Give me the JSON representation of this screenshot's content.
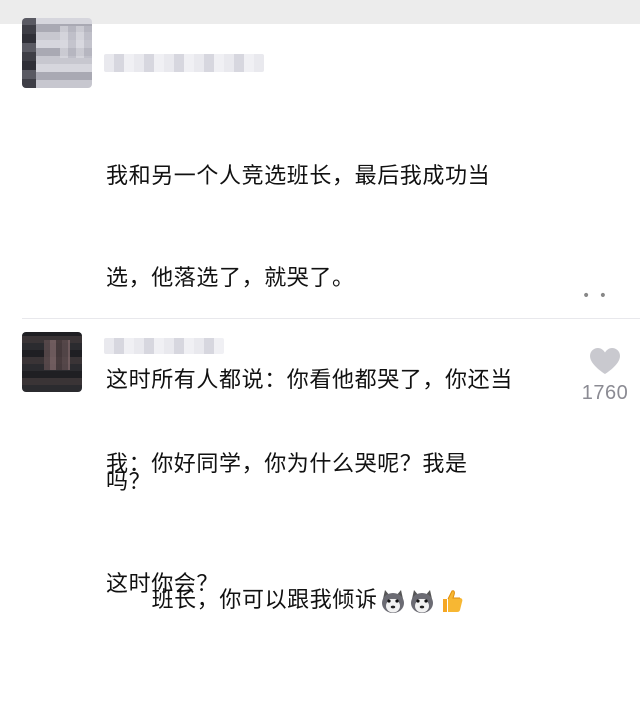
{
  "post": {
    "line1": "我和另一个人竞选班长，最后我成功当",
    "line2": "选，他落选了，就哭了。",
    "line3": "这时所有人都说：你看他都哭了，你还当",
    "line4": "吗？",
    "line5": "这时你会？"
  },
  "reply": {
    "line1": "我：你好同学，你为什么哭呢？我是",
    "line2": "班长，你可以跟我倾诉",
    "emoji": [
      "husky-emoji",
      "husky-emoji",
      "thumbs-up-emoji"
    ],
    "like_count": "1760"
  },
  "colors": {
    "top_strip": "#ececec",
    "heart": "#c9c9cf",
    "like_text": "#8b8b93"
  }
}
